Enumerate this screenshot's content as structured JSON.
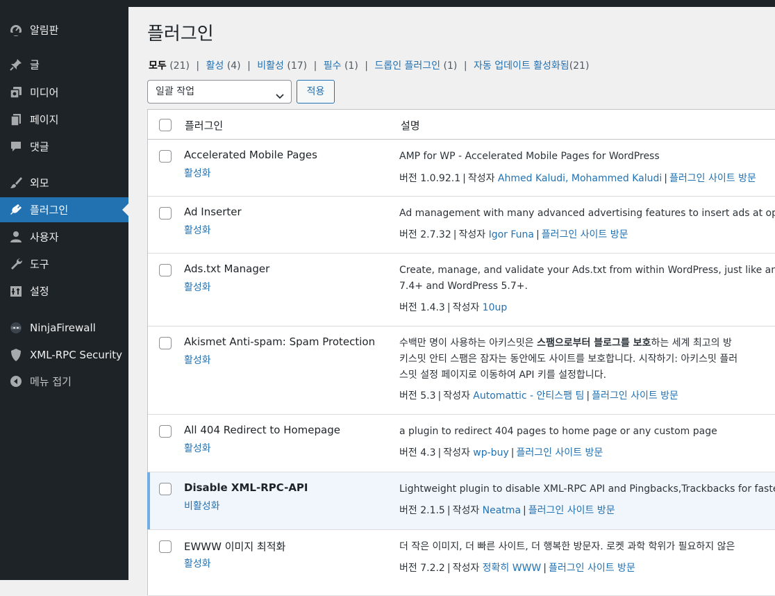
{
  "sidebar": {
    "items": [
      {
        "label": "알림판",
        "icon": "dashboard-icon"
      },
      {
        "label": "글",
        "icon": "pin-icon"
      },
      {
        "label": "미디어",
        "icon": "media-icon"
      },
      {
        "label": "페이지",
        "icon": "pages-icon"
      },
      {
        "label": "댓글",
        "icon": "comments-icon"
      },
      {
        "label": "외모",
        "icon": "brush-icon"
      },
      {
        "label": "플러그인",
        "icon": "plugin-icon"
      },
      {
        "label": "사용자",
        "icon": "user-icon"
      },
      {
        "label": "도구",
        "icon": "wrench-icon"
      },
      {
        "label": "설정",
        "icon": "settings-icon"
      },
      {
        "label": "NinjaFirewall",
        "icon": "ninja-icon"
      },
      {
        "label": "XML-RPC Security",
        "icon": "shield-icon"
      },
      {
        "label": "메뉴 접기",
        "icon": "collapse-icon"
      }
    ],
    "active": "플러그인",
    "colors": {
      "bg": "#1d2327",
      "active": "#2271b1"
    }
  },
  "page": {
    "title": "플러그인"
  },
  "filters": [
    {
      "label": "모두",
      "count": "(21)"
    },
    {
      "label": "활성",
      "count": "(4)"
    },
    {
      "label": "비활성",
      "count": "(17)"
    },
    {
      "label": "필수",
      "count": "(1)"
    },
    {
      "label": "드롭인 플러그인",
      "count": "(1)"
    },
    {
      "label": "자동 업데이트 활성화됨",
      "count": "(21)"
    }
  ],
  "bulk": {
    "selected": "일괄 작업",
    "apply": "적용"
  },
  "table": {
    "col_plugin": "플러그인",
    "col_desc": "설명",
    "rows": [
      {
        "name": "Accelerated Mobile Pages",
        "action": "활성화",
        "desc": "AMP for WP - Accelerated Mobile Pages for WordPress",
        "version": "버전 1.0.92.1",
        "by": "작성자",
        "author": "Ahmed Kaludi, Mohammed Kaludi",
        "site": "플러그인 사이트 방문"
      },
      {
        "name": "Ad Inserter",
        "action": "활성화",
        "desc": "Ad management with many advanced advertising features to insert ads at optimal",
        "version": "버전 2.7.32",
        "by": "작성자",
        "author": "Igor Funa",
        "site": "플러그인 사이트 방문"
      },
      {
        "name": "Ads.txt Manager",
        "action": "활성화",
        "desc1": "Create, manage, and validate your Ads.txt from within WordPress, just like any othe",
        "desc2": "7.4+ and WordPress 5.7+.",
        "version": "버전 1.4.3",
        "by": "작성자",
        "author": "10up"
      },
      {
        "name": "Akismet Anti-spam: Spam Protection",
        "action": "활성화",
        "desc1a": "수백만 명이 사용하는 아키스밋은 ",
        "desc1b": "스팸으로부터 블로그를 보호",
        "desc1c": "하는 세계 최고의 방",
        "desc2": "키스밋 안티 스팸은 잠자는 동안에도 사이트를 보호합니다. 시작하기: 아키스밋 플러",
        "desc3": "스밋 설정 페이지로 이동하여 API 키를 설정합니다.",
        "version": "버전 5.3",
        "by": "작성자",
        "author": "Automattic - 안티스팸 팀",
        "site": "플러그인 사이트 방문"
      },
      {
        "name": "All 404 Redirect to Homepage",
        "action": "활성화",
        "desc": "a plugin to redirect 404 pages to home page or any custom page",
        "version": "버전 4.3",
        "by": "작성자",
        "author": "wp-buy",
        "site": "플러그인 사이트 방문"
      },
      {
        "name": "Disable XML-RPC-API",
        "action": "비활성화",
        "desc": "Lightweight plugin to disable XML-RPC API and Pingbacks,Trackbacks for faster and",
        "version": "버전 2.1.5",
        "by": "작성자",
        "author": "Neatma",
        "site": "플러그인 사이트 방문"
      },
      {
        "name": "EWWW 이미지 최적화",
        "action": "활성화",
        "desc": "더 작은 이미지, 더 빠른 사이트, 더 행복한 방문자. 로켓 과학 학위가 필요하지 않은",
        "version": "버전 7.2.2",
        "by": "작성자",
        "author": "정확히 WWW",
        "site": "플러그인 사이트 방문"
      }
    ]
  }
}
